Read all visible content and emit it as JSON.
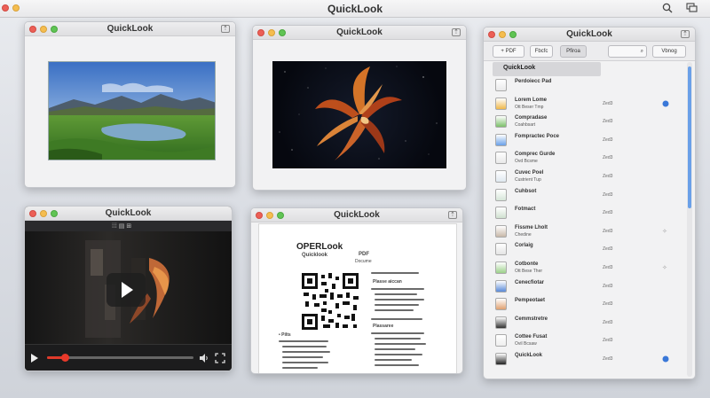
{
  "menubar": {
    "title": "QuickLook",
    "search_icon": "search-icon",
    "window_icon": "windows-icon"
  },
  "windows": {
    "image": {
      "title": "QuickLook"
    },
    "flame": {
      "title": "QuickLook"
    },
    "video": {
      "title": "QuickLook",
      "toolbar_label": "⁞⁞⁞ ▤ ⊞",
      "progress": 0.12
    },
    "document": {
      "title": "QuickLook",
      "heading": "OPERLook",
      "subheading": "Quicklook",
      "pdf_label": "PDF",
      "pdf_sub": "Docume",
      "left_bullets_label": "• Pilts",
      "right_text_top": "Plasse aiccan",
      "right_text_mid": "Plassaree"
    },
    "list": {
      "title": "QuickLook",
      "toolbar": {
        "add": "+ PDF",
        "filter": "Fbcfc",
        "preview": "Pfiroa",
        "view": "Vbnog"
      },
      "selected_label": "QuickLook",
      "rows": [
        {
          "name": "Perdoiecc Pad",
          "sub": "",
          "size": ""
        },
        {
          "name": "Lorem Lome",
          "sub": "Ott Beser Tmp",
          "size": "Zed3"
        },
        {
          "name": "Compradase",
          "sub": "Coahbsart",
          "size": "Zed3"
        },
        {
          "name": "Fompractec Poce",
          "sub": "",
          "size": "Zed3"
        },
        {
          "name": "Comprec Gurde",
          "sub": "Ovd Bcsme",
          "size": "Zed3"
        },
        {
          "name": "Cuvec Poel",
          "sub": "Custrient Tup",
          "size": "Zed3"
        },
        {
          "name": "Cuhbsot",
          "sub": "",
          "size": "Zed3"
        },
        {
          "name": "Fotmact",
          "sub": "",
          "size": "Zed3"
        },
        {
          "name": "Fissme Lholt",
          "sub": "Chedine",
          "size": "Zed3"
        },
        {
          "name": "Corlaig",
          "sub": "",
          "size": "Zed3"
        },
        {
          "name": "Cotbonte",
          "sub": "Ott Bese Ther",
          "size": "Zed3"
        },
        {
          "name": "Cenecfiotar",
          "sub": "",
          "size": "Zed3"
        },
        {
          "name": "Pempeotaet",
          "sub": "",
          "size": "Zed3"
        },
        {
          "name": "Cemmstretre",
          "sub": "",
          "size": "Zed3"
        },
        {
          "name": "Cottee Fusat",
          "sub": "Ovil Bcsaw",
          "size": "Zed3"
        },
        {
          "name": "QuickLook",
          "sub": "",
          "size": "Zed3"
        }
      ]
    }
  }
}
